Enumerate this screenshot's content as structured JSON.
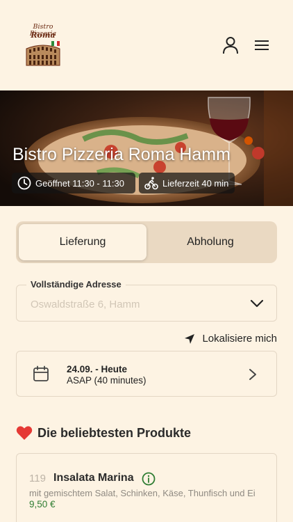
{
  "header": {
    "logo": {
      "line1": "Bistro Pizzeria",
      "line2": "Roma"
    },
    "user_icon": "user-icon",
    "menu_icon": "hamburger-menu-icon"
  },
  "hero": {
    "title": "Bistro Pizzeria Roma Hamm",
    "opening_hours": "Geöffnet 11:30 - 11:30",
    "delivery_time": "Lieferzeit 40 min"
  },
  "order_type": {
    "tabs": [
      {
        "label": "Lieferung",
        "selected": true
      },
      {
        "label": "Abholung",
        "selected": false
      }
    ]
  },
  "address": {
    "label": "Vollständige Adresse",
    "placeholder": "Oswaldstraße 6, Hamm"
  },
  "locate": {
    "label": "Lokalisiere mich"
  },
  "schedule": {
    "date": "24.09. - Heute",
    "time": "ASAP (40 minutes)"
  },
  "popular": {
    "title": "Die beliebtesten Produkte",
    "products": [
      {
        "number": "119",
        "name": "Insalata Marina",
        "description": "mit gemischtem Salat, Schinken, Käse, Thunfisch und Ei",
        "price": "9,50 €"
      }
    ]
  },
  "colors": {
    "background": "#fdf3e3",
    "toggle_bg": "#ead9c2",
    "price_green": "#2e7d32",
    "heart_red": "#e53935"
  }
}
